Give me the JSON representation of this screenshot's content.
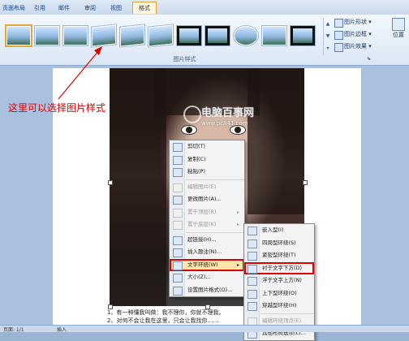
{
  "ribbon_tabs": [
    "页面布局",
    "引用",
    "邮件",
    "审阅",
    "视图",
    "格式"
  ],
  "active_tab": "格式",
  "gallery": {
    "group_label": "图片样式",
    "thumb_styles": [
      "plain",
      "plain",
      "plain",
      "tilt",
      "tilt",
      "tilt",
      "framed",
      "framed",
      "oval",
      "plain",
      "framed"
    ],
    "selected_index": 0
  },
  "picture_commands": [
    "图片形状",
    "图片边框",
    "图片效果"
  ],
  "position_label": "位置",
  "annotation": "这里可以选择图片样式",
  "watermark": {
    "title": "电脑百事网",
    "url": "www.pc841.com"
  },
  "context_menu": [
    {
      "label": "剪切(T)",
      "icon": "scissors-icon",
      "enabled": true
    },
    {
      "label": "复制(C)",
      "icon": "copy-icon",
      "enabled": true
    },
    {
      "label": "粘贴(P)",
      "icon": "paste-icon",
      "enabled": true
    },
    {
      "sep": true
    },
    {
      "label": "编辑图片(E)",
      "icon": "",
      "enabled": false
    },
    {
      "label": "更改图片(A)...",
      "icon": "change-picture-icon",
      "enabled": true
    },
    {
      "label": "置于顶层(R)",
      "icon": "bring-front-icon",
      "enabled": false,
      "submenu": true
    },
    {
      "label": "置于底层(K)",
      "icon": "send-back-icon",
      "enabled": false,
      "submenu": true
    },
    {
      "sep": true
    },
    {
      "label": "超链接(H)...",
      "icon": "hyperlink-icon",
      "enabled": true
    },
    {
      "label": "插入题注(N)...",
      "icon": "caption-icon",
      "enabled": true
    },
    {
      "label": "文字环绕(W)",
      "icon": "text-wrap-icon",
      "enabled": true,
      "submenu": true,
      "highlight": true,
      "boxed": true
    },
    {
      "label": "大小(Z)...",
      "icon": "size-icon",
      "enabled": true
    },
    {
      "label": "设置图片格式(O)...",
      "icon": "format-picture-icon",
      "enabled": true
    }
  ],
  "wrap_submenu": [
    {
      "label": "嵌入型(I)",
      "enabled": true
    },
    {
      "label": "四周型环绕(S)",
      "enabled": true
    },
    {
      "label": "紧密型环绕(T)",
      "enabled": true
    },
    {
      "label": "衬于文字下方(D)",
      "enabled": true,
      "boxed": true
    },
    {
      "label": "浮于文字上方(N)",
      "enabled": true
    },
    {
      "label": "上下型环绕(O)",
      "enabled": true
    },
    {
      "label": "穿越型环绕(H)",
      "enabled": true
    },
    {
      "sep": true
    },
    {
      "label": "编辑环绕顶点(E)",
      "enabled": false
    },
    {
      "label": "其他布局选项(L)...",
      "enabled": true
    }
  ],
  "document_lines": [
    "1、有一种懂我叫做：我不理你，你就不理我。",
    "2、对何不会让我在这里，只会让我找你……"
  ],
  "status": {
    "left": "页面: 1/1",
    "right": "插入"
  },
  "colors": {
    "accent": "#e00000",
    "ribbon": "#dbe7f5",
    "highlight": "#ffe6a8"
  }
}
